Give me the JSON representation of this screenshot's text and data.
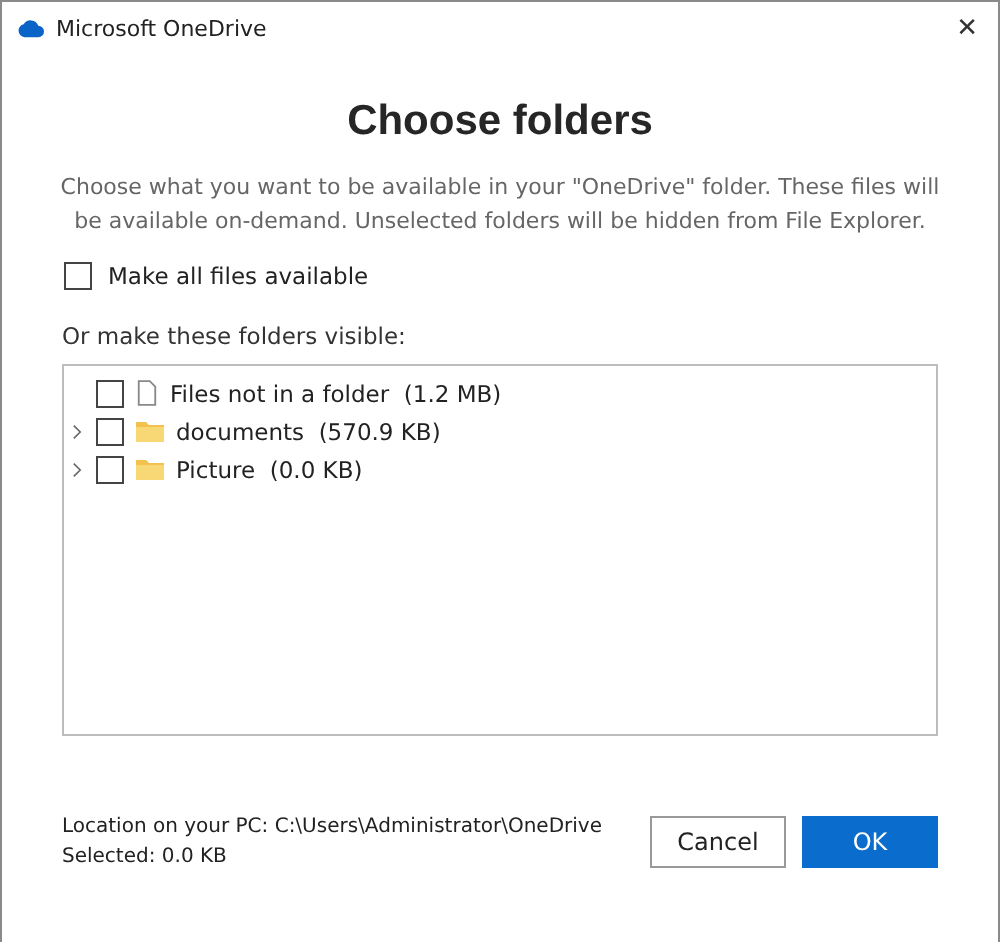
{
  "window": {
    "title": "Microsoft OneDrive",
    "close": "✕"
  },
  "heading": "Choose folders",
  "description": "Choose what you want to be available in your \"OneDrive\" folder. These files will be available on-demand. Unselected folders will be hidden from File Explorer.",
  "make_all": {
    "label": "Make all files available",
    "checked": false
  },
  "folders_label": "Or make these folders visible:",
  "tree": [
    {
      "kind": "file",
      "name": "Files not in a folder",
      "size": "(1.2 MB)",
      "checked": false,
      "expandable": false
    },
    {
      "kind": "folder",
      "name": "documents",
      "size": "(570.9 KB)",
      "checked": false,
      "expandable": true
    },
    {
      "kind": "folder",
      "name": "Picture",
      "size": "(0.0 KB)",
      "checked": false,
      "expandable": true
    }
  ],
  "location": "Location on your PC: C:\\Users\\Administrator\\OneDrive",
  "selected": "Selected: 0.0 KB",
  "buttons": [
    {
      "label": "Cancel",
      "kind": "secondary"
    },
    {
      "label": "OK",
      "kind": "primary"
    }
  ]
}
